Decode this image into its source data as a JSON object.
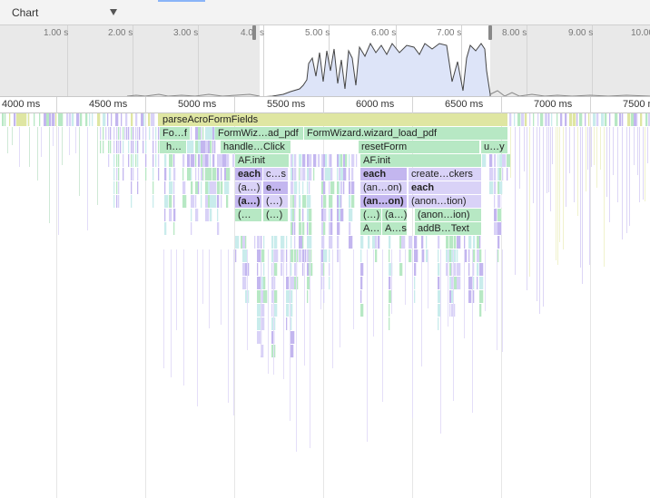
{
  "toolbar": {
    "view_label": "Chart"
  },
  "overview": {
    "tick_labels": [
      "1.00 s",
      "2.00 s",
      "3.00 s",
      "4.0",
      "s",
      "5.00 s",
      "6.00 s",
      "7.00 s",
      "8.00 s",
      "9.00 s",
      "10.00"
    ]
  },
  "ruler": {
    "labels": [
      "4000 ms",
      "4500 ms",
      "5000 ms",
      "5500 ms",
      "6000 ms",
      "6500 ms",
      "7000 ms",
      "7500 m"
    ]
  },
  "flame": {
    "frames": [
      "parseAcroFormFields",
      "Fo…f",
      "FormWiz…ad_pdf",
      "FormWizard.wizard_load_pdf",
      "h…",
      "handle…Click",
      "resetForm",
      "u…y",
      "AF.init",
      "AF.init",
      "each",
      "c…s",
      "each",
      "create…ckers",
      "(a…)",
      "e…",
      "(an…on)",
      "each",
      "(a…)",
      "(…)",
      "(an…on)",
      "(anon…tion)",
      "(…",
      "(…)",
      "(…)",
      "(a…)",
      "(anon…ion)",
      "A…",
      "A…s",
      "addB…Text"
    ]
  },
  "colors": {
    "yellow": "#dfe6a2",
    "green": "#b7e8c4",
    "lavender": "#d9d2f7",
    "purple": "#c3b6ef",
    "teal": "#c9ecec",
    "selection_fill": "#dde4f8",
    "selection_stroke": "#444444"
  }
}
